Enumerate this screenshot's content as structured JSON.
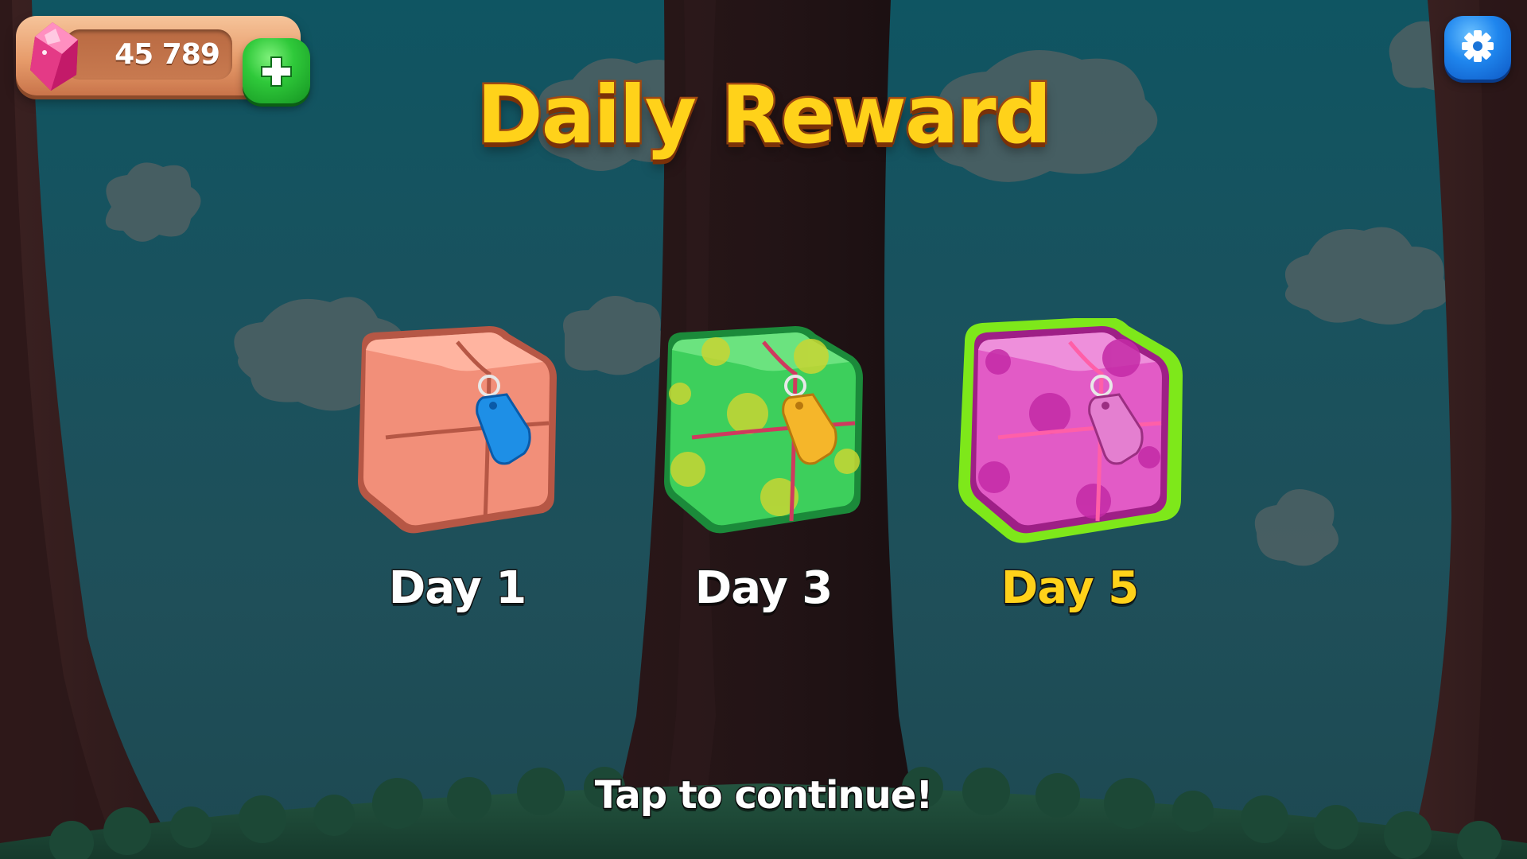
{
  "hud": {
    "gem_count": "45 789",
    "gem_icon": "pink-gem-icon",
    "add_button_icon": "plus-icon",
    "settings_icon": "gear-icon"
  },
  "title": "Daily Reward",
  "rewards": [
    {
      "label": "Day 1",
      "box_color": "#f08a72",
      "tag_color": "#1e8fe6",
      "pattern": "plain",
      "state": "claimed"
    },
    {
      "label": "Day 3",
      "box_color": "#3dcf5c",
      "tag_color": "#f5b62a",
      "pattern": "yellow-dots",
      "state": "locked"
    },
    {
      "label": "Day 5",
      "box_color": "#e25bc6",
      "tag_color": "#e47fd0",
      "pattern": "magenta-dots",
      "state": "current"
    }
  ],
  "footer": {
    "prompt": "Tap to continue!"
  },
  "colors": {
    "title_yellow": "#ffd21a",
    "title_outline": "#a34a12",
    "highlight_green": "#7ee81a",
    "sky_teal": "#19525e"
  }
}
